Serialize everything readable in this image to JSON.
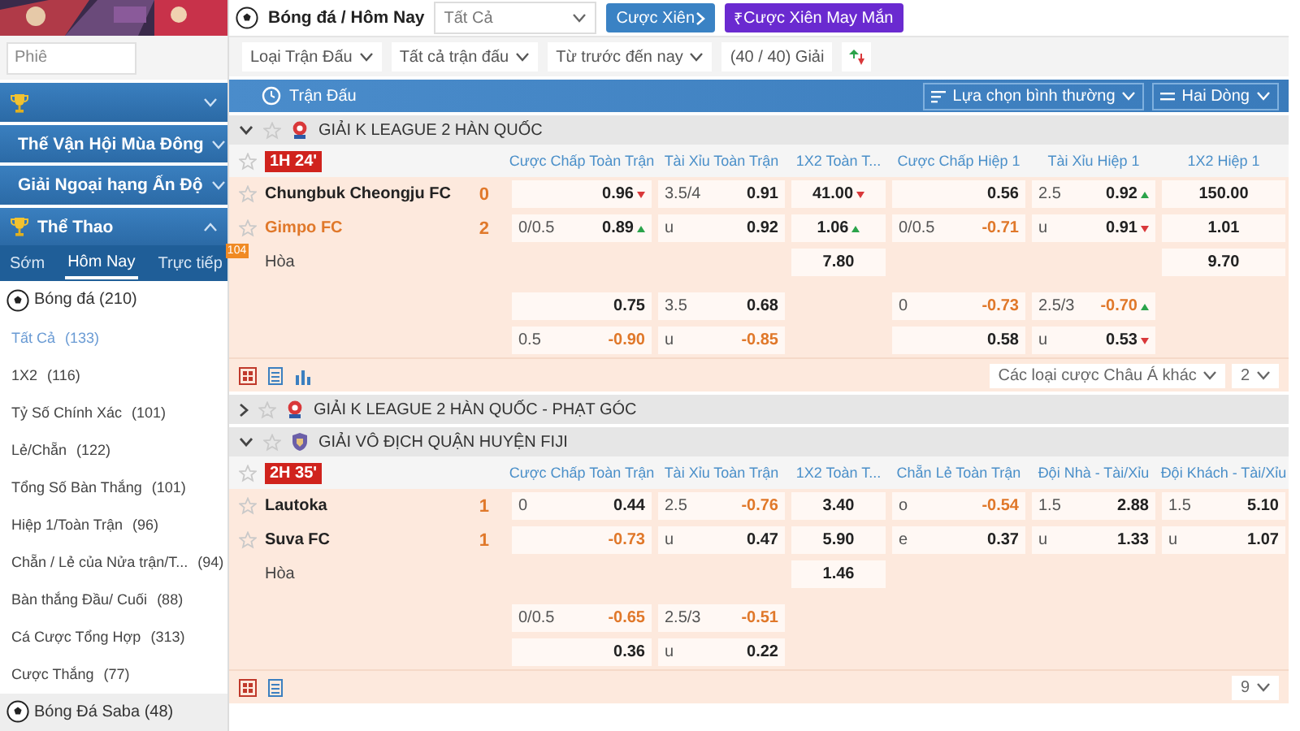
{
  "sidebar": {
    "dropdown": "Phiê",
    "sections": [
      {
        "expanded": false
      },
      {
        "label": "Thế Vận Hội Mùa Đông",
        "expanded": false
      },
      {
        "label": "Giải Ngoại hạng Ấn Độ",
        "expanded": false
      },
      {
        "label": "Thể Thao",
        "expanded": true
      }
    ],
    "tabs": [
      {
        "label": "Sớm",
        "selected": false
      },
      {
        "label": "Hôm Nay",
        "selected": true
      },
      {
        "label": "Trực tiếp",
        "selected": false,
        "badge": "104"
      }
    ],
    "sport": {
      "label": "Bóng đá",
      "count": "(210)"
    },
    "items": [
      {
        "label": "Tất Cả",
        "count": "(133)",
        "selected": true
      },
      {
        "label": "1X2",
        "count": "(116)",
        "selected": false
      },
      {
        "label": "Tỷ Số Chính Xác",
        "count": "(101)",
        "selected": false
      },
      {
        "label": "Lẻ/Chẵn",
        "count": "(122)",
        "selected": false
      },
      {
        "label": "Tổng Số Bàn Thắng",
        "count": "(101)",
        "selected": false
      },
      {
        "label": "Hiệp 1/Toàn Trận",
        "count": "(96)",
        "selected": false
      },
      {
        "label": "Chẵn / Lẻ của Nửa trận/T...",
        "count": "(94)",
        "selected": false
      },
      {
        "label": "Bàn thắng Đầu/ Cuối",
        "count": "(88)",
        "selected": false
      },
      {
        "label": "Cá Cược Tổng Hợp",
        "count": "(313)",
        "selected": false
      },
      {
        "label": "Cược Thắng",
        "count": "(77)",
        "selected": false
      }
    ],
    "sport_2": {
      "label": "Bóng Đá Saba",
      "count": "(48)"
    }
  },
  "top_bar": {
    "title": "Bóng đá / Hôm Nay",
    "filter": "Tất Cả",
    "buttons": [
      {
        "kind": "parlay",
        "label": "Cược Xiên"
      },
      {
        "kind": "lucky",
        "symbol": "₹",
        "label": "Cược Xiên May Mắn"
      }
    ]
  },
  "filters": {
    "dropdowns": [
      "Loại Trận Đấu",
      "Tất cả trận đấu",
      "Từ trước đến nay"
    ],
    "count": "(40 / 40) Giải"
  },
  "section_bar": {
    "title": "Trận Đấu",
    "dropdowns": [
      {
        "kind": "filter",
        "label": "Lựa chọn bình thường"
      },
      {
        "kind": "lines",
        "label": "Hai Dòng"
      }
    ]
  },
  "leagues": [
    {
      "name": "GIẢI K LEAGUE 2 HÀN QUỐC",
      "expanded": true,
      "match": {
        "time": "1H 24'",
        "columns": [
          "Cược Chấp Toàn Trận",
          "Tài Xỉu Toàn Trận",
          "1X2 Toàn T...",
          "Cược Chấp Hiệp 1",
          "Tài Xỉu Hiệp 1",
          "1X2 Hiệp 1"
        ],
        "lines": [
          {
            "kind": "team",
            "label": "Chungbuk Cheongju FC",
            "score": "0",
            "highlight": false,
            "cells": [
              {
                "kind": "pair",
                "odds": "0.96",
                "falling": true
              },
              {
                "kind": "pair",
                "line": "3.5/4",
                "odds": "0.91"
              },
              {
                "kind": "single",
                "odds": "41.00",
                "falling": true
              },
              {
                "kind": "pair",
                "odds": "0.56"
              },
              {
                "kind": "pair",
                "line": "2.5",
                "odds": "0.92",
                "rising": true
              },
              {
                "kind": "single",
                "odds": "150.00"
              }
            ]
          },
          {
            "kind": "team",
            "label": "Gimpo FC",
            "score": "2",
            "highlight": true,
            "cells": [
              {
                "kind": "pair",
                "line": "0/0.5",
                "odds": "0.89",
                "rising": true
              },
              {
                "kind": "pair",
                "line": "u",
                "odds": "0.92"
              },
              {
                "kind": "single",
                "odds": "1.06",
                "rising": true
              },
              {
                "kind": "pair",
                "line": "0/0.5",
                "odds": "-0.71",
                "negative": true
              },
              {
                "kind": "pair",
                "line": "u",
                "odds": "0.91",
                "falling": true
              },
              {
                "kind": "single",
                "odds": "1.01"
              }
            ]
          },
          {
            "kind": "draw",
            "label": "Hòa",
            "cells": [
              null,
              null,
              {
                "kind": "single",
                "odds": "7.80"
              },
              null,
              null,
              {
                "kind": "single",
                "odds": "9.70"
              }
            ]
          },
          {
            "kind": "extra",
            "cells": [
              {
                "kind": "pair",
                "odds": "0.75"
              },
              {
                "kind": "pair",
                "line": "3.5",
                "odds": "0.68"
              },
              null,
              {
                "kind": "pair",
                "line": "0",
                "odds": "-0.73",
                "negative": true
              },
              {
                "kind": "pair",
                "line": "2.5/3",
                "odds": "-0.70",
                "negative": true,
                "rising": true
              },
              null
            ]
          },
          {
            "kind": "extra",
            "cells": [
              {
                "kind": "pair",
                "line": "0.5",
                "odds": "-0.90",
                "negative": true
              },
              {
                "kind": "pair",
                "line": "u",
                "odds": "-0.85",
                "negative": true
              },
              null,
              {
                "kind": "pair",
                "odds": "0.58"
              },
              {
                "kind": "pair",
                "line": "u",
                "odds": "0.53",
                "falling": true
              },
              null
            ]
          }
        ],
        "stats_icon": true,
        "selects": [
          "Các loại cược Châu Á khác",
          "2"
        ]
      }
    },
    {
      "name": "GIẢI K LEAGUE 2 HÀN QUỐC - PHẠT GÓC",
      "expanded": false
    },
    {
      "name": "GIẢI VÔ ĐỊCH QUẬN HUYỆN FIJI",
      "expanded": true,
      "match": {
        "time": "2H 35'",
        "columns": [
          "Cược Chấp Toàn Trận",
          "Tài Xỉu Toàn Trận",
          "1X2 Toàn T...",
          "Chẵn Lẻ Toàn Trận",
          "Đội Nhà - Tài/Xỉu",
          "Đội Khách - Tài/Xỉu"
        ],
        "lines": [
          {
            "kind": "team",
            "label": "Lautoka",
            "score": "1",
            "highlight": false,
            "cells": [
              {
                "kind": "pair",
                "line": "0",
                "odds": "0.44"
              },
              {
                "kind": "pair",
                "line": "2.5",
                "odds": "-0.76",
                "negative": true
              },
              {
                "kind": "single",
                "odds": "3.40"
              },
              {
                "kind": "pair",
                "line": "o",
                "odds": "-0.54",
                "negative": true
              },
              {
                "kind": "pair",
                "line": "1.5",
                "odds": "2.88"
              },
              {
                "kind": "pair",
                "line": "1.5",
                "odds": "5.10"
              }
            ]
          },
          {
            "kind": "team",
            "label": "Suva FC",
            "score": "1",
            "highlight": false,
            "cells": [
              {
                "kind": "pair",
                "odds": "-0.73",
                "negative": true
              },
              {
                "kind": "pair",
                "line": "u",
                "odds": "0.47"
              },
              {
                "kind": "single",
                "odds": "5.90"
              },
              {
                "kind": "pair",
                "line": "e",
                "odds": "0.37"
              },
              {
                "kind": "pair",
                "line": "u",
                "odds": "1.33"
              },
              {
                "kind": "pair",
                "line": "u",
                "odds": "1.07"
              }
            ]
          },
          {
            "kind": "draw",
            "label": "Hòa",
            "cells": [
              null,
              null,
              {
                "kind": "single",
                "odds": "1.46"
              },
              null,
              null,
              null
            ]
          },
          {
            "kind": "extra",
            "cells": [
              {
                "kind": "pair",
                "line": "0/0.5",
                "odds": "-0.65",
                "negative": true
              },
              {
                "kind": "pair",
                "line": "2.5/3",
                "odds": "-0.51",
                "negative": true
              },
              null,
              null,
              null,
              null
            ]
          },
          {
            "kind": "extra",
            "cells": [
              {
                "kind": "pair",
                "odds": "0.36"
              },
              {
                "kind": "pair",
                "line": "u",
                "odds": "0.22"
              },
              null,
              null,
              null,
              null
            ]
          }
        ],
        "stats_icon": false,
        "selects": [
          "9"
        ]
      }
    }
  ]
}
